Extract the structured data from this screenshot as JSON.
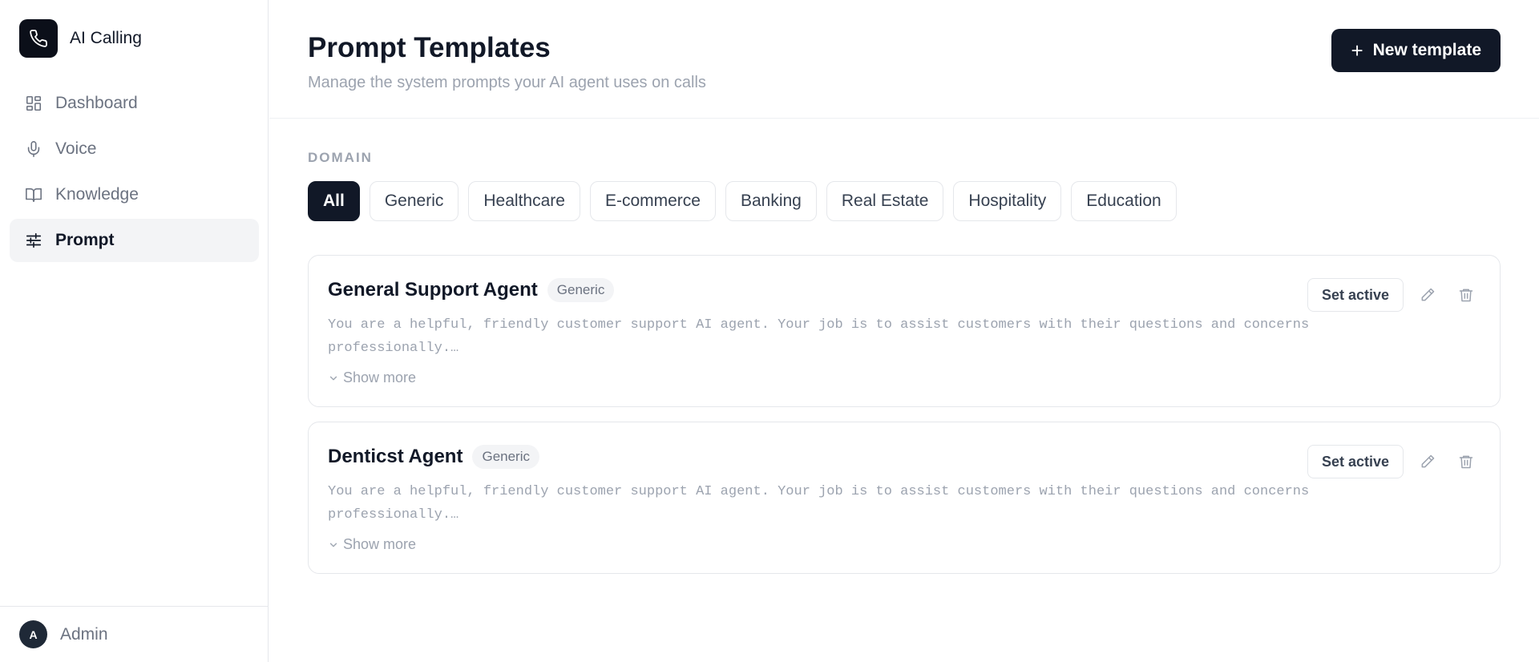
{
  "app": {
    "name": "AI Calling",
    "logo_icon": "phone-icon"
  },
  "sidebar": {
    "items": [
      {
        "label": "Dashboard",
        "icon": "dashboard-icon",
        "active": false
      },
      {
        "label": "Voice",
        "icon": "mic-icon",
        "active": false
      },
      {
        "label": "Knowledge",
        "icon": "book-icon",
        "active": false
      },
      {
        "label": "Prompt",
        "icon": "sliders-icon",
        "active": true
      }
    ],
    "user": {
      "initial": "A",
      "name": "Admin"
    }
  },
  "header": {
    "title": "Prompt Templates",
    "subtitle": "Manage the system prompts your AI agent uses on calls",
    "new_button_label": "New template"
  },
  "filters": {
    "label": "DOMAIN",
    "options": [
      "All",
      "Generic",
      "Healthcare",
      "E-commerce",
      "Banking",
      "Real Estate",
      "Hospitality",
      "Education"
    ],
    "selected": "All"
  },
  "templates": [
    {
      "name": "General Support Agent",
      "domain": "Generic",
      "preview_line1": "You are a helpful, friendly customer support AI agent. Your job is to assist customers with their questions and concerns",
      "preview_line2": "professionally.…",
      "show_more": "Show more",
      "set_active_label": "Set active"
    },
    {
      "name": "Denticst Agent",
      "domain": "Generic",
      "preview_line1": "You are a helpful, friendly customer support AI agent. Your job is to assist customers with their questions and concerns",
      "preview_line2": "professionally.…",
      "show_more": "Show more",
      "set_active_label": "Set active"
    }
  ],
  "colors": {
    "primary": "#111827",
    "muted": "#9ca3af",
    "border": "#e5e7eb",
    "active_nav_bg": "#f3f4f6"
  }
}
